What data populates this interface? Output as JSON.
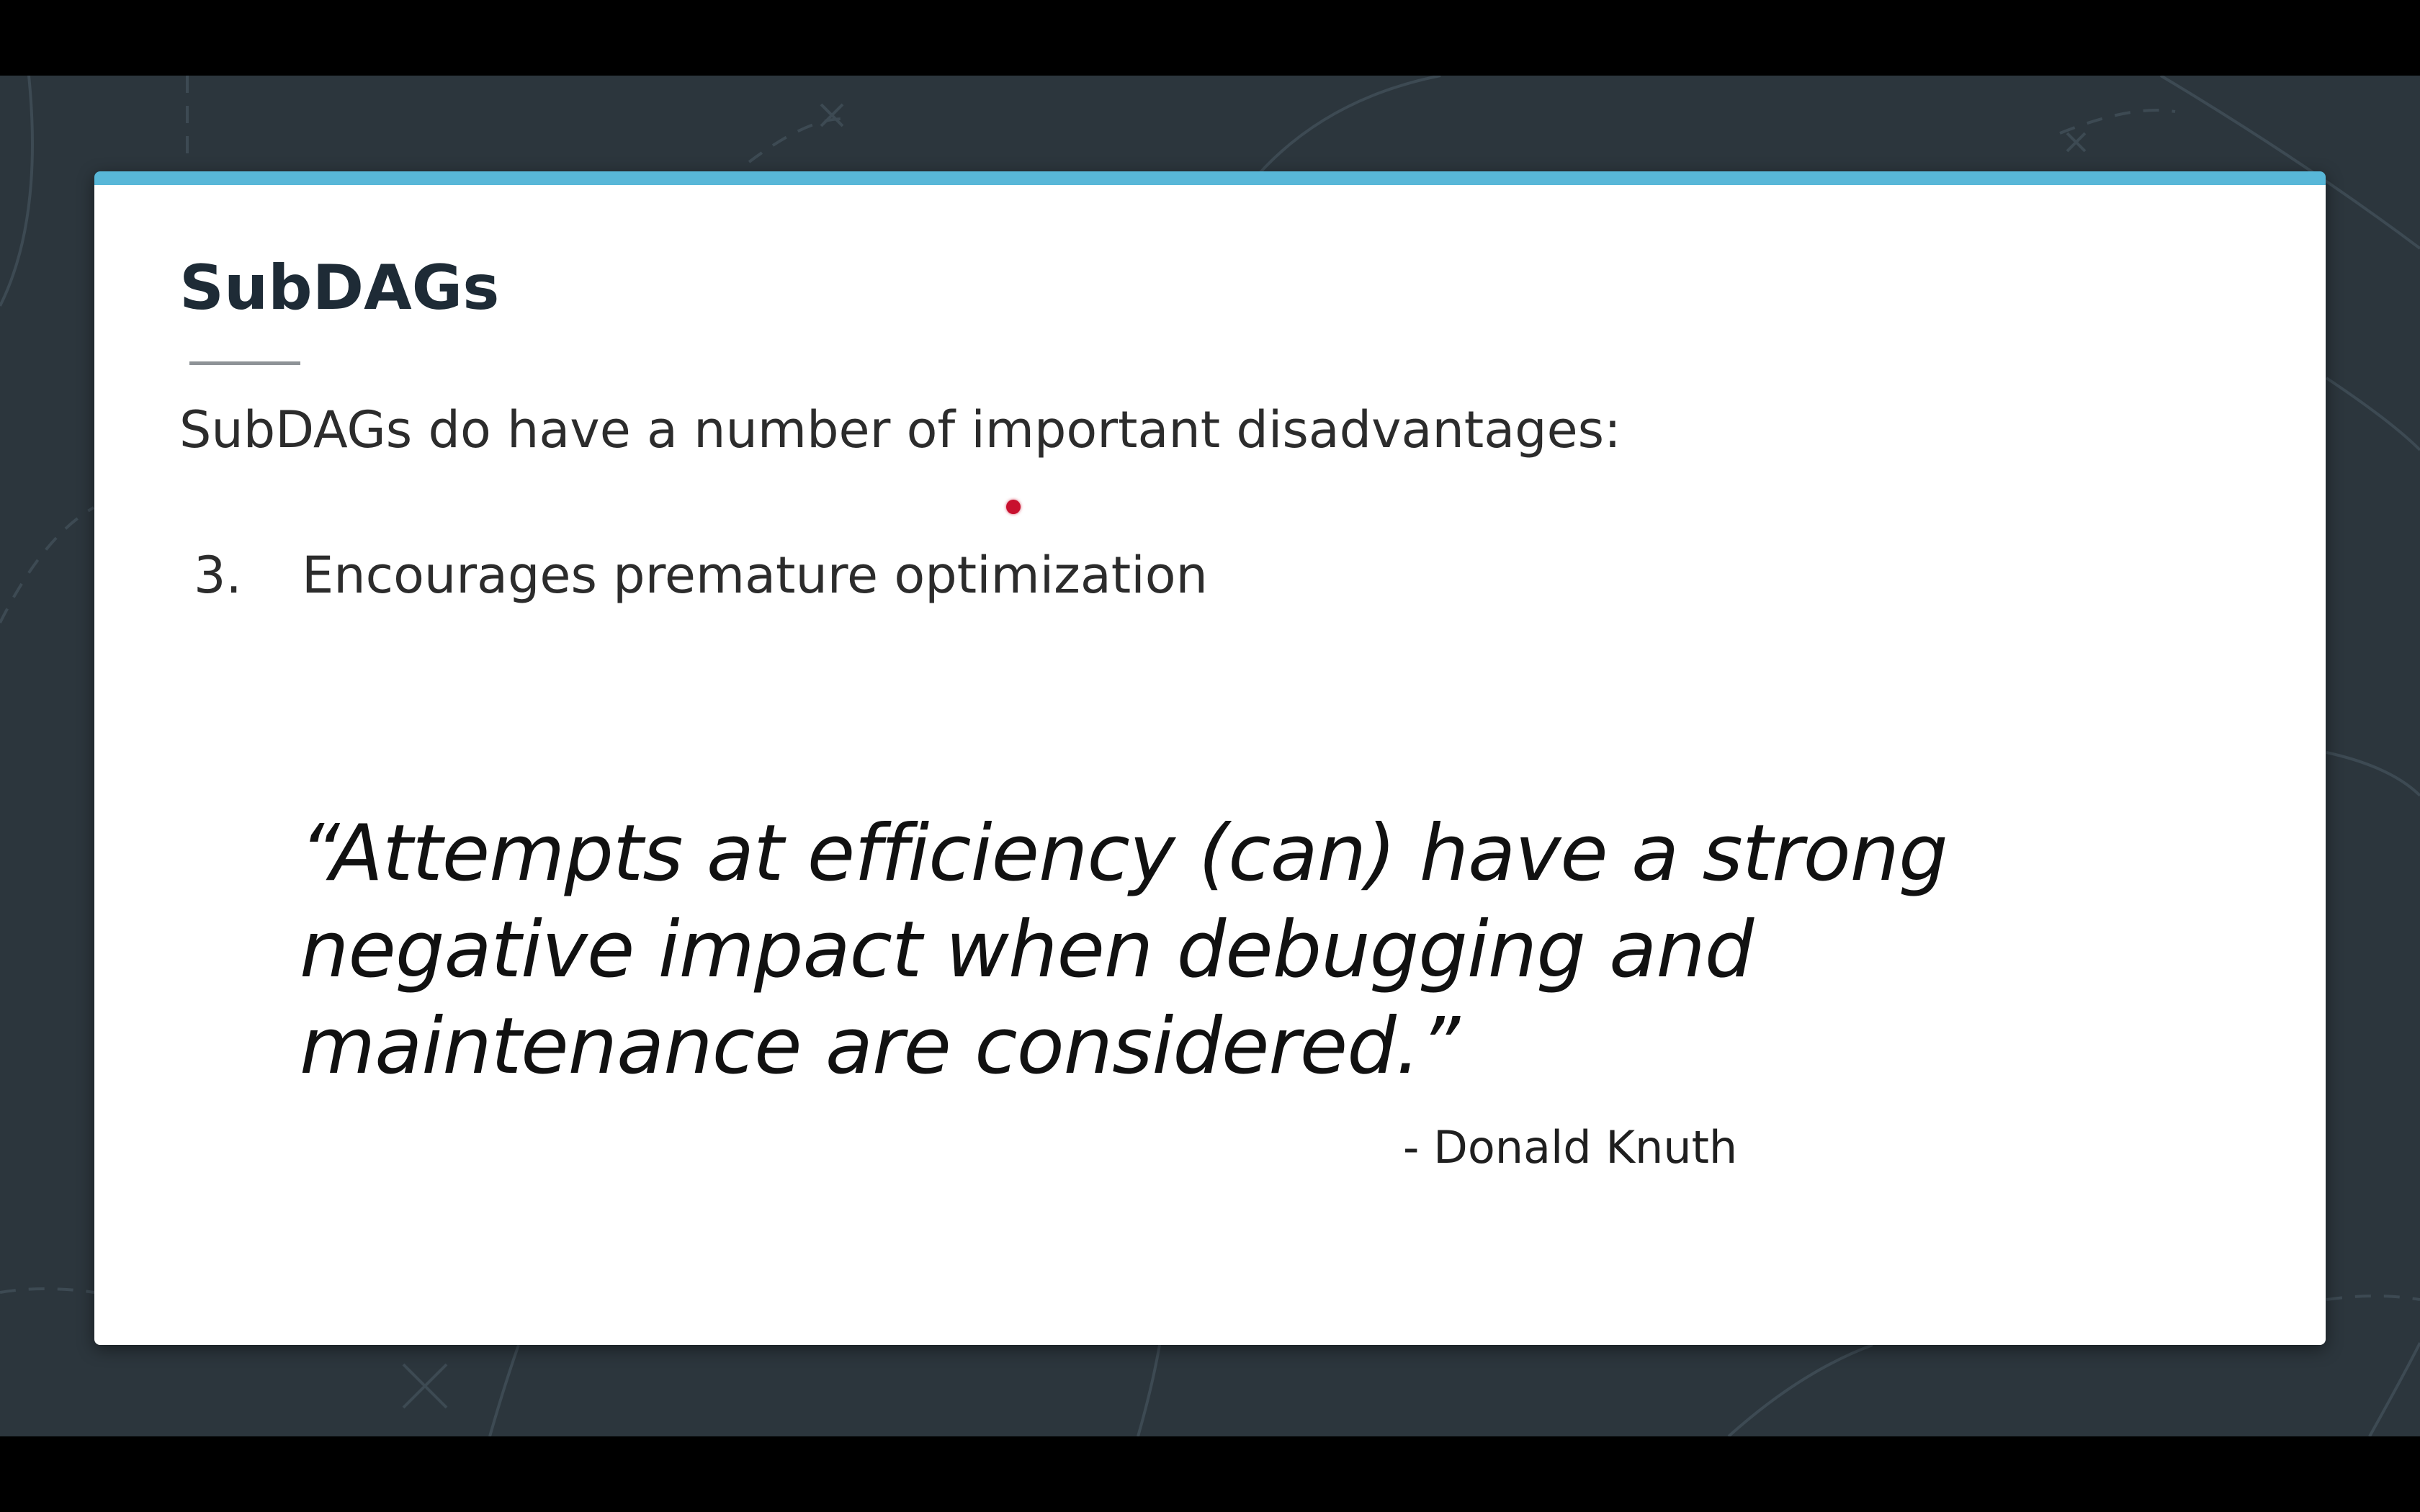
{
  "slide": {
    "title": "SubDAGs",
    "intro": "SubDAGs do have a number of important disadvantages:",
    "list": [
      {
        "number": "3.",
        "text": "Encourages premature optimization"
      }
    ],
    "quote": "“Attempts at efficiency (can) have a strong negative impact when debugging and maintenance are considered.”",
    "attribution": "- Donald Knuth"
  },
  "colors": {
    "background": "#2c363d",
    "card": "#ffffff",
    "accent_bar": "#58b7d8",
    "title_text": "#1e2b36",
    "pointer": "#c8102e"
  }
}
